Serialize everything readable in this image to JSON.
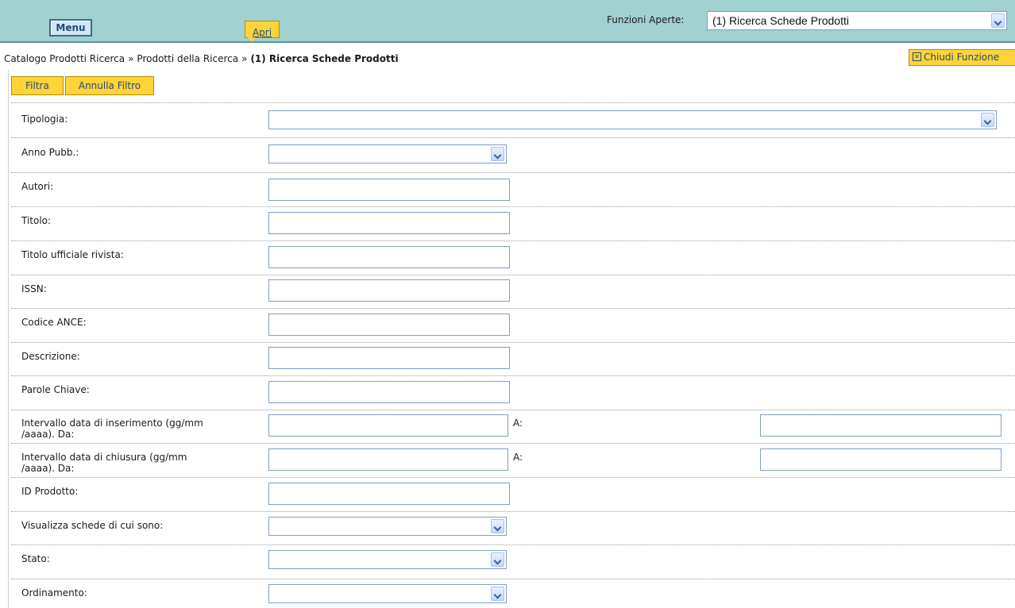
{
  "topbar": {
    "menu_label": "Menu",
    "apri_label": "Apri",
    "funzioni_aperte_label": "Funzioni Aperte:",
    "funzioni_aperte_value": "(1) Ricerca Schede Prodotti"
  },
  "breadcrumb": {
    "items": [
      "Catalogo Prodotti Ricerca",
      "Prodotti della Ricerca"
    ],
    "separator": "»",
    "current": "(1) Ricerca Schede Prodotti"
  },
  "chiudi_funzione_label": "Chiudi Funzione",
  "toolbar": {
    "filtra_label": "Filtra",
    "annulla_filtro_label": "Annulla Filtro"
  },
  "form": {
    "tipologia": {
      "label": "Tipologia:",
      "value": ""
    },
    "anno_pubb": {
      "label": "Anno Pubb.:",
      "value": ""
    },
    "autori": {
      "label": "Autori:",
      "value": ""
    },
    "titolo": {
      "label": "Titolo:",
      "value": ""
    },
    "titolo_rivista": {
      "label": "Titolo ufficiale rivista:",
      "value": ""
    },
    "issn": {
      "label": "ISSN:",
      "value": ""
    },
    "codice_ance": {
      "label": "Codice ANCE:",
      "value": ""
    },
    "descrizione": {
      "label": "Descrizione:",
      "value": ""
    },
    "parole_chiave": {
      "label": "Parole Chiave:",
      "value": ""
    },
    "data_inserimento": {
      "label_line1": "Intervallo data di inserimento (gg/mm",
      "label_line2": "/aaaa). Da:",
      "a_label": "A:",
      "from": "",
      "to": ""
    },
    "data_chiusura": {
      "label_line1": "Intervallo data di chiusura (gg/mm",
      "label_line2": "/aaaa). Da:",
      "a_label": "A:",
      "from": "",
      "to": ""
    },
    "id_prodotto": {
      "label": "ID Prodotto:",
      "value": ""
    },
    "visualizza_schede": {
      "label": "Visualizza schede di cui sono:",
      "value": ""
    },
    "stato": {
      "label": "Stato:",
      "value": ""
    },
    "ordinamento": {
      "label": "Ordinamento:",
      "value": ""
    }
  },
  "colors": {
    "topbar_bg": "#a0d0d0",
    "button_yellow": "#ffd33a",
    "button_text": "#1f4b79",
    "input_border": "#7fa0c4"
  }
}
